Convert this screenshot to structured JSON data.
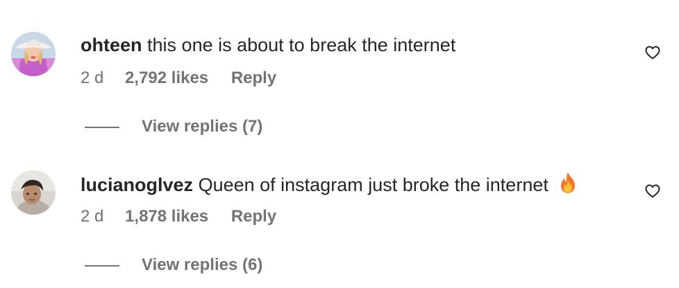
{
  "comments": [
    {
      "username": "ohteen",
      "text": "this one is about to break the internet",
      "time": "2 d",
      "likes": "2,792 likes",
      "reply_label": "Reply",
      "view_replies": "View replies (7)",
      "avatar_icon": "avatar-photo-icon",
      "like_icon": "heart-outline-icon"
    },
    {
      "username": "lucianoglvez",
      "text": "Queen of instagram just broke the internet",
      "emoji": "fire-emoji-icon",
      "time": "2 d",
      "likes": "1,878 likes",
      "reply_label": "Reply",
      "view_replies": "View replies (6)",
      "avatar_icon": "avatar-photo-icon",
      "like_icon": "heart-outline-icon"
    }
  ],
  "colors": {
    "primary_text": "#262626",
    "secondary_text": "#737373",
    "background": "#ffffff"
  }
}
